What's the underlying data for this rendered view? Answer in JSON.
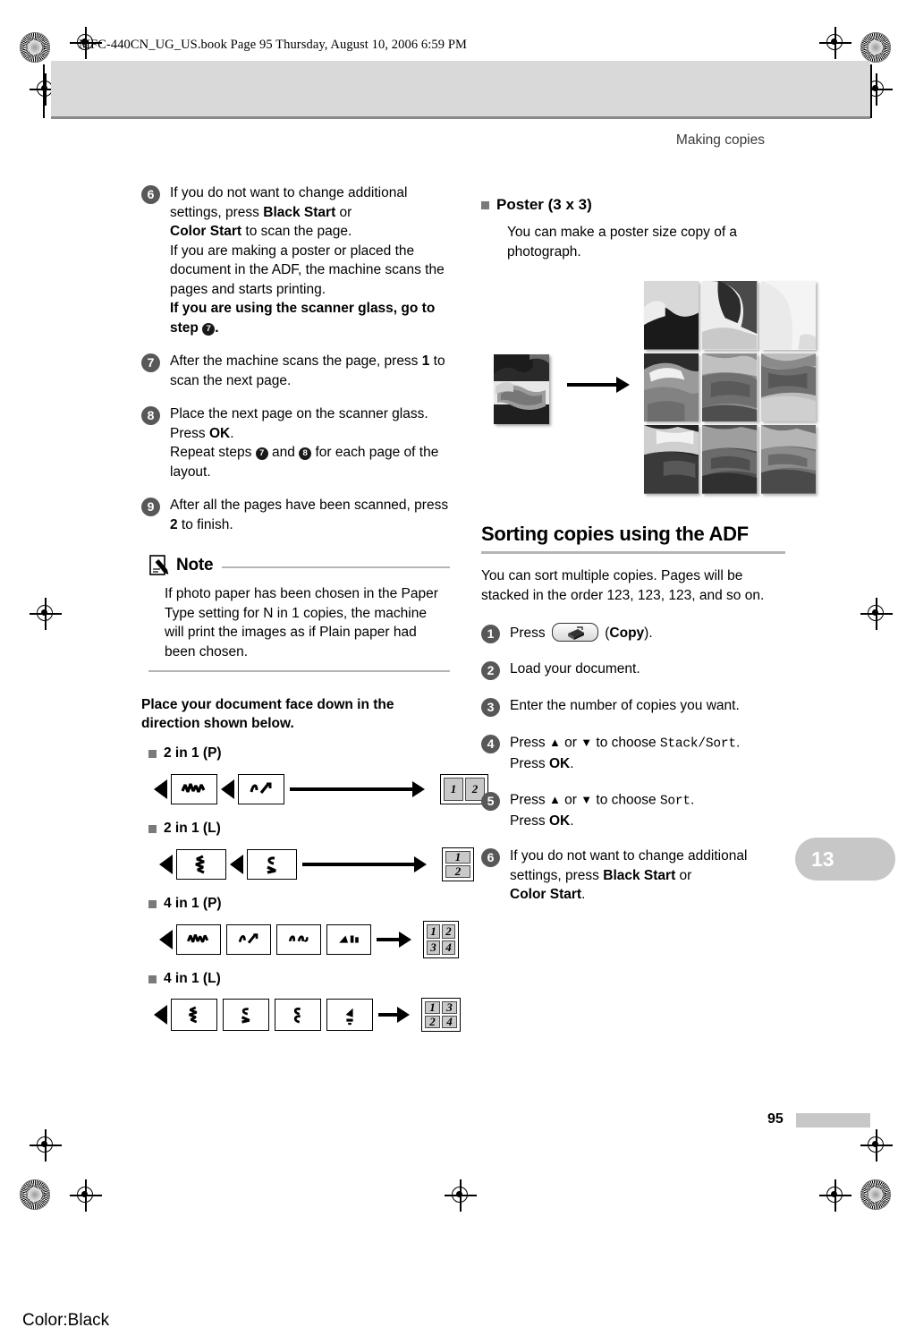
{
  "prepress": {
    "book_line": "MFC-440CN_UG_US.book  Page 95  Thursday, August 10, 2006  6:59 PM",
    "color_label": "Color:Black"
  },
  "header": {
    "running_head": "Making copies"
  },
  "chapter_tab": {
    "number": "13"
  },
  "footer": {
    "page_number": "95"
  },
  "left_column": {
    "steps": [
      {
        "number": "6",
        "segments": [
          {
            "text": "If you do not want to change additional settings, press ",
            "style": "normal"
          },
          {
            "text": "Black Start",
            "style": "bold"
          },
          {
            "text": " or ",
            "style": "normal"
          },
          {
            "text": "Color Start",
            "style": "bold"
          },
          {
            "text": " to scan the page.",
            "style": "normal"
          },
          {
            "text": "If you are making a poster or placed the document in the ADF, the machine scans the pages and starts printing.",
            "style": "normal-break"
          },
          {
            "text": "If you are using the scanner glass, go to step ",
            "style": "bold-break"
          },
          {
            "text": "7",
            "style": "circled"
          },
          {
            "text": ".",
            "style": "bold"
          }
        ]
      },
      {
        "number": "7",
        "segments": [
          {
            "text": "After the machine scans the page, press ",
            "style": "normal"
          },
          {
            "text": "1",
            "style": "bold"
          },
          {
            "text": " to scan the next page.",
            "style": "normal"
          }
        ]
      },
      {
        "number": "8",
        "segments": [
          {
            "text": "Place the next page on the scanner glass.",
            "style": "normal"
          },
          {
            "text": "Press ",
            "style": "normal-break"
          },
          {
            "text": "OK",
            "style": "bold"
          },
          {
            "text": ".",
            "style": "normal"
          },
          {
            "text": "Repeat steps ",
            "style": "normal-break"
          },
          {
            "text": "7",
            "style": "circled"
          },
          {
            "text": " and ",
            "style": "normal"
          },
          {
            "text": "8",
            "style": "circled"
          },
          {
            "text": " for each page of the layout.",
            "style": "normal"
          }
        ]
      },
      {
        "number": "9",
        "segments": [
          {
            "text": "After all the pages have been scanned, press ",
            "style": "normal"
          },
          {
            "text": "2",
            "style": "bold"
          },
          {
            "text": " to finish.",
            "style": "normal"
          }
        ]
      }
    ],
    "note": {
      "title": "Note",
      "body": "If photo paper has been chosen in the Paper Type setting for N in 1 copies, the machine will print the images as if Plain paper had been chosen."
    },
    "lead_in": "Place your document face down in the direction shown below.",
    "layouts": [
      {
        "label": "2 in 1 (P)",
        "orientation": "portrait",
        "input_pages": 2,
        "output_cols": 2,
        "output_rows": 1,
        "output_cells": [
          "1",
          "2"
        ]
      },
      {
        "label": "2 in 1 (L)",
        "orientation": "landscape",
        "input_pages": 2,
        "output_cols": 1,
        "output_rows": 2,
        "output_cells": [
          "1",
          "2"
        ]
      },
      {
        "label": "4 in 1 (P)",
        "orientation": "portrait",
        "input_pages": 4,
        "output_cols": 2,
        "output_rows": 2,
        "output_cells": [
          "1",
          "2",
          "3",
          "4"
        ]
      },
      {
        "label": "4 in 1 (L)",
        "orientation": "landscape",
        "input_pages": 4,
        "output_cols": 2,
        "output_rows": 2,
        "output_cells": [
          "1",
          "3",
          "2",
          "4"
        ]
      }
    ]
  },
  "right_column": {
    "poster": {
      "label": "Poster (3 x 3)",
      "body": "You can make a poster size copy of a photograph.",
      "figure_caption_source": "photograph",
      "grid_rows": 3,
      "grid_cols": 3
    },
    "section": {
      "title": "Sorting copies using the ADF",
      "intro": "You can sort multiple copies. Pages will be stacked in the order 123, 123, 123, and so on."
    },
    "steps": [
      {
        "number": "1",
        "segments": [
          {
            "text": "Press ",
            "style": "normal"
          },
          {
            "text": "copy-button",
            "style": "icon"
          },
          {
            "text": " (",
            "style": "normal"
          },
          {
            "text": "Copy",
            "style": "bold"
          },
          {
            "text": ").",
            "style": "normal"
          }
        ]
      },
      {
        "number": "2",
        "segments": [
          {
            "text": "Load your document.",
            "style": "normal"
          }
        ]
      },
      {
        "number": "3",
        "segments": [
          {
            "text": "Enter the number of copies you want.",
            "style": "normal"
          }
        ]
      },
      {
        "number": "4",
        "segments": [
          {
            "text": "Press ",
            "style": "normal"
          },
          {
            "text": "▲",
            "style": "glyph"
          },
          {
            "text": " or ",
            "style": "normal"
          },
          {
            "text": "▼",
            "style": "glyph"
          },
          {
            "text": " to choose ",
            "style": "normal"
          },
          {
            "text": "Stack/Sort",
            "style": "lcd"
          },
          {
            "text": ".",
            "style": "normal"
          },
          {
            "text": "Press ",
            "style": "normal-break"
          },
          {
            "text": "OK",
            "style": "bold"
          },
          {
            "text": ".",
            "style": "normal"
          }
        ]
      },
      {
        "number": "5",
        "segments": [
          {
            "text": "Press ",
            "style": "normal"
          },
          {
            "text": "▲",
            "style": "glyph"
          },
          {
            "text": " or ",
            "style": "normal"
          },
          {
            "text": "▼",
            "style": "glyph"
          },
          {
            "text": " to choose ",
            "style": "normal"
          },
          {
            "text": "Sort",
            "style": "lcd"
          },
          {
            "text": ".",
            "style": "normal"
          },
          {
            "text": "Press ",
            "style": "normal-break"
          },
          {
            "text": "OK",
            "style": "bold"
          },
          {
            "text": ".",
            "style": "normal"
          }
        ]
      },
      {
        "number": "6",
        "segments": [
          {
            "text": "If you do not want to change additional settings, press ",
            "style": "normal"
          },
          {
            "text": "Black Start",
            "style": "bold"
          },
          {
            "text": " or ",
            "style": "normal"
          },
          {
            "text": "Color Start",
            "style": "bold"
          },
          {
            "text": ".",
            "style": "normal"
          }
        ]
      }
    ]
  },
  "colors": {
    "step_circle": "#585858",
    "tab_gray": "#c7c7c7",
    "rule_gray": "#b5b5b5",
    "band_gray": "#d9d9d9"
  }
}
